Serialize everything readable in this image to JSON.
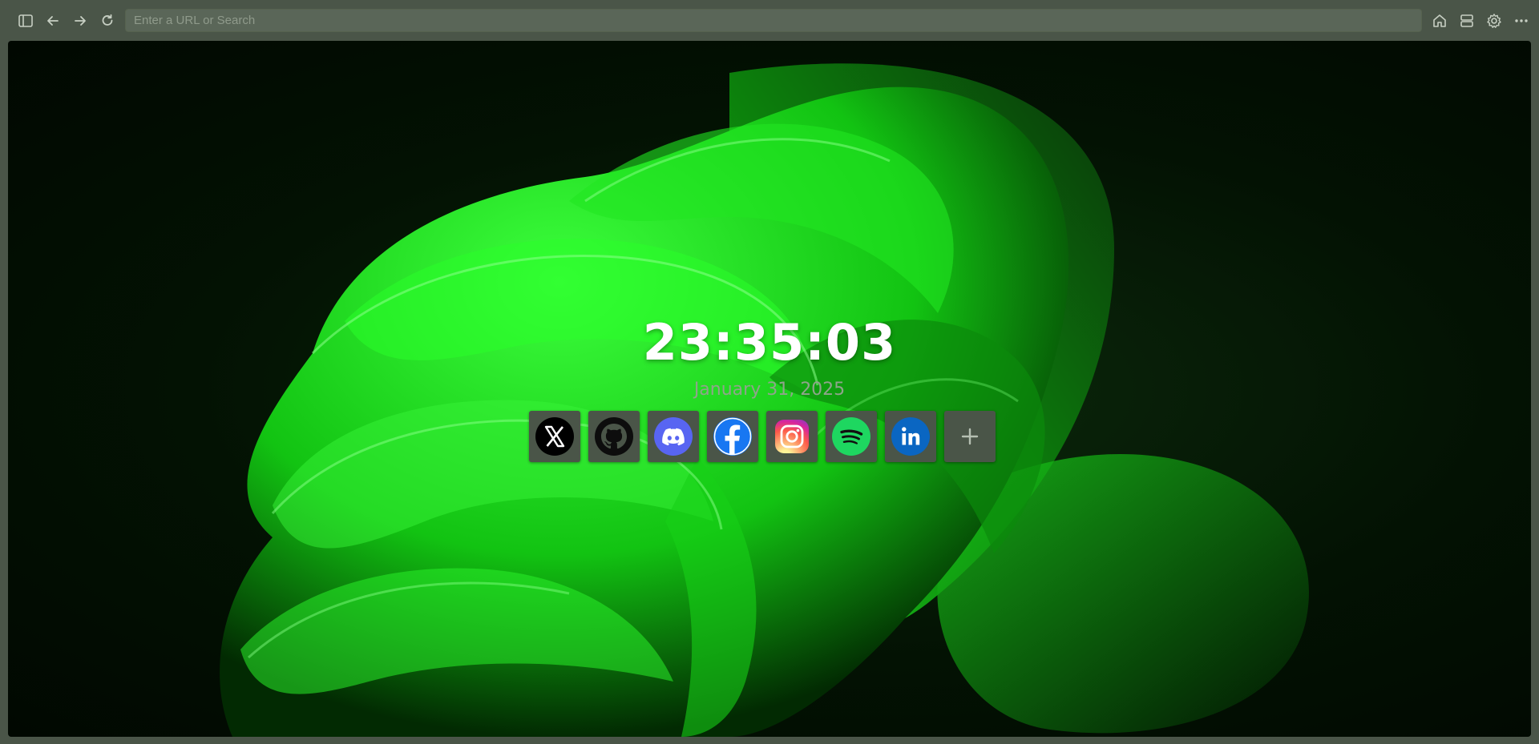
{
  "toolbar": {
    "url_placeholder": "Enter a URL or Search",
    "url_value": "",
    "buttons": {
      "sidebar": "sidebar-toggle-icon",
      "back": "arrow-left-icon",
      "forward": "arrow-right-icon",
      "reload": "reload-icon",
      "home": "home-icon",
      "tabs": "tab-stack-icon",
      "settings": "gear-icon",
      "menu": "more-dots-icon"
    }
  },
  "newtab": {
    "time": "23:35:03",
    "date": "January 31, 2025",
    "shortcuts": [
      {
        "name": "X",
        "icon": "x-icon",
        "color": "#000000"
      },
      {
        "name": "GitHub",
        "icon": "github-icon",
        "color": "#000000"
      },
      {
        "name": "Discord",
        "icon": "discord-icon",
        "color": "#5865f2"
      },
      {
        "name": "Facebook",
        "icon": "facebook-icon",
        "color": "#1877f2"
      },
      {
        "name": "Instagram",
        "icon": "instagram-icon",
        "color": "#e1306c"
      },
      {
        "name": "Spotify",
        "icon": "spotify-icon",
        "color": "#1ed760"
      },
      {
        "name": "LinkedIn",
        "icon": "linkedin-icon",
        "color": "#0a66c2"
      },
      {
        "name": "Add shortcut",
        "icon": "plus-icon",
        "color": "#b5bfb2"
      }
    ]
  },
  "colors": {
    "chrome": "#4a5548",
    "urlbar": "#5a6658",
    "accent_green": "#17e317"
  }
}
